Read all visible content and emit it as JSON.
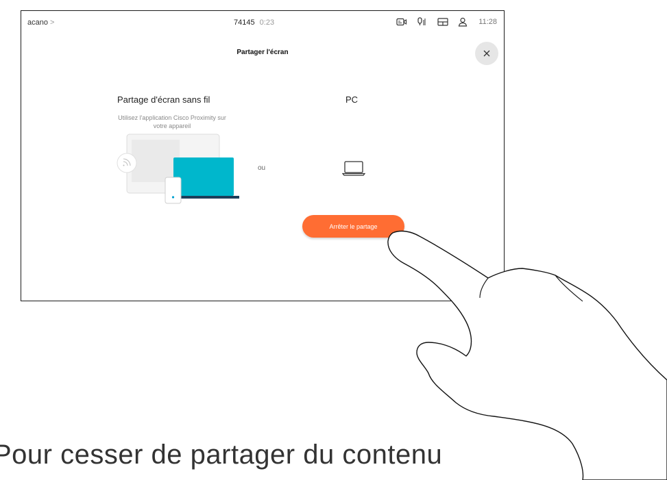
{
  "statusbar": {
    "breadcrumb": "acano",
    "breadcrumb_chevron": ">",
    "call_number": "74145",
    "call_duration": "0:23",
    "icons": [
      "camera-icon",
      "microphone-icon",
      "layout-icon",
      "person-icon"
    ],
    "clock": "11:28"
  },
  "dialog": {
    "title": "Partager l'écran",
    "close_icon": "close-icon",
    "wireless": {
      "title": "Partage d'écran sans fil",
      "description_line1": "Utilisez l'application Cisco Proximity sur",
      "description_line2": "votre appareil"
    },
    "separator": "ou",
    "pc": {
      "title": "PC",
      "icon": "laptop-icon"
    },
    "stop_button": "Arrêter le partage"
  },
  "colors": {
    "accent_orange": "#ff6d33",
    "laptop_teal": "#00b7cc",
    "phone_dot": "#00a0d1"
  },
  "caption": "Pour cesser de partager du contenu"
}
